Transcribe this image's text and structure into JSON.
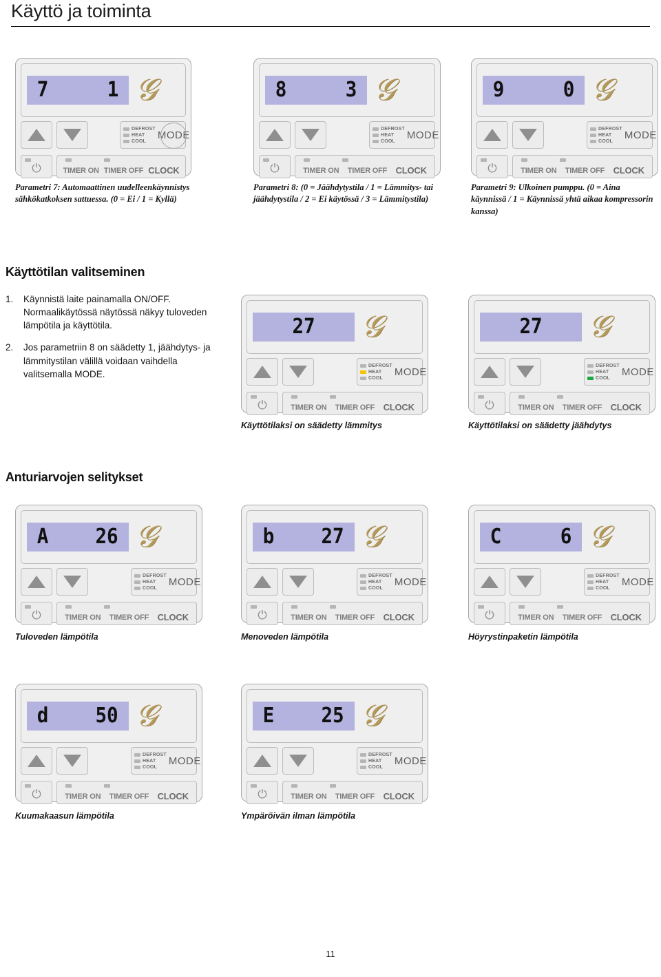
{
  "document": {
    "title": "Käyttö ja toiminta",
    "page_number": "11"
  },
  "parameter_row": {
    "items": [
      {
        "display_left": "7",
        "display_right": "1",
        "caption": "Parametri 7: Automaattinen uudelleenkäynnistys sähkökatkoksen sattuessa. (0 = Ei / 1 = Kyllä)"
      },
      {
        "display_left": "8",
        "display_right": "3",
        "caption": "Parametri 8: (0 = Jäähdytystila / 1 = Lämmitys- tai jäähdytystila / 2 = Ei käytössä / 3 = Lämmitystila)"
      },
      {
        "display_left": "9",
        "display_right": "0",
        "caption": "Parametri 9: Ulkoinen pumppu. (0 = Aina käynnissä / 1 = Käynnissä yhtä aikaa kompressorin kanssa)"
      }
    ]
  },
  "mode_section": {
    "heading": "Käyttötilan valitseminen",
    "steps": [
      {
        "number": "1.",
        "text": "Käynnistä laite painamalla ON/OFF. Normaalikäytössä näytössä näkyy tuloveden lämpötila ja käyttötila."
      },
      {
        "number": "2.",
        "text": "Jos parametriin 8 on säädetty 1, jäähdytys- ja lämmitystilan välillä voidaan vaihdella valitsemalla MODE."
      }
    ],
    "panels": [
      {
        "display": "27",
        "active_led": "heat",
        "caption": "Käyttötilaksi on säädetty lämmitys"
      },
      {
        "display": "27",
        "active_led": "cool",
        "caption": "Käyttötilaksi on säädetty jäähdytys"
      }
    ]
  },
  "sensor_section": {
    "heading": "Anturiarvojen selitykset",
    "panels": [
      {
        "display_left": "A",
        "display_right": "26",
        "caption": "Tuloveden lämpötila"
      },
      {
        "display_left": "b",
        "display_right": "27",
        "caption": "Menoveden lämpötila"
      },
      {
        "display_left": "C",
        "display_right": "6",
        "caption": "Höyrystinpaketin lämpötila"
      },
      {
        "display_left": "d",
        "display_right": "50",
        "caption": "Kuumakaasun lämpötila"
      },
      {
        "display_left": "E",
        "display_right": "25",
        "caption": "Ympäröivän ilman lämpötila"
      }
    ]
  },
  "panel_ui": {
    "brand_glyph": "𝒢",
    "led_labels": [
      "DEFROST",
      "HEAT",
      "COOL"
    ],
    "mode_label": "MODE",
    "power_glyph": "⏻",
    "timer_on_label": "TIMER ON",
    "timer_off_label": "TIMER OFF",
    "clock_label": "CLOCK"
  },
  "colors": {
    "lcd_background": "#b4b2de",
    "brand_gold": "#b49a5a",
    "led_off": "#b5b5b5",
    "led_heat_on": "#f5c400",
    "led_cool_on": "#19a844",
    "panel_body": "#f0f0f0"
  }
}
